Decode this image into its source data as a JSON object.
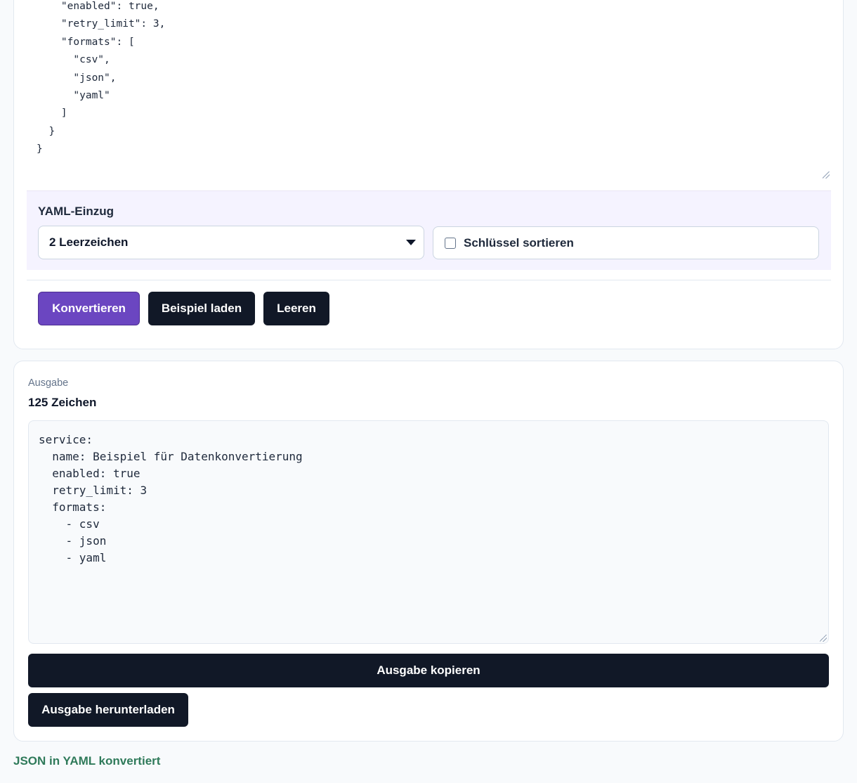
{
  "input": {
    "json_lines": [
      "    \"enabled\": true,",
      "    \"retry_limit\": 3,",
      "    \"formats\": [",
      "      \"csv\",",
      "      \"json\",",
      "      \"yaml\"",
      "    ]",
      "  }",
      "}"
    ]
  },
  "options": {
    "indent_label": "YAML-Einzug",
    "indent_selected": "2 Leerzeichen",
    "sort_keys_label": "Schlüssel sortieren",
    "sort_keys_checked": false
  },
  "actions": {
    "convert_label": "Konvertieren",
    "example_label": "Beispiel laden",
    "clear_label": "Leeren"
  },
  "output": {
    "label": "Ausgabe",
    "count": "125 Zeichen",
    "yaml_lines": [
      "service:",
      "  name: Beispiel für Datenkonvertierung",
      "  enabled: true",
      "  retry_limit: 3",
      "  formats:",
      "    - csv",
      "    - json",
      "    - yaml"
    ],
    "copy_label": "Ausgabe kopieren",
    "download_label": "Ausgabe herunterladen"
  },
  "status": {
    "message": "JSON in YAML konvertiert"
  },
  "colors": {
    "primary": "#6b46c1",
    "dark_button": "#111827",
    "status_green": "#2f7a5a",
    "options_band": "#f5f3ff"
  }
}
